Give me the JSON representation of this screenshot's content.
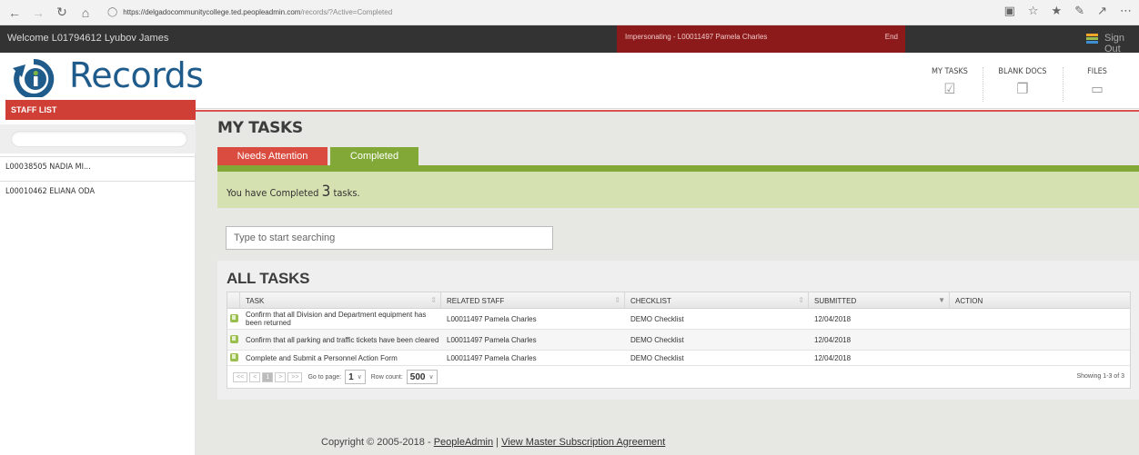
{
  "browser": {
    "url_domain": "https://delgadocommunitycollege.ted.peopleadmin.com",
    "url_path": "/records/?Active=Completed"
  },
  "topbar": {
    "welcome": "Welcome L01794612 Lyubov James",
    "impersonating": "Impersonating - L00011497 Pamela Charles",
    "end": "End",
    "sign_out": "Sign Out",
    "menu_colors": [
      "#f4a62a",
      "#9bbf4f",
      "#3d8fd1"
    ]
  },
  "header": {
    "logo_text": "Records",
    "nav": [
      {
        "label": "MY TASKS",
        "icon": "checkbox-icon"
      },
      {
        "label": "BLANK DOCS",
        "icon": "documents-icon"
      },
      {
        "label": "FILES",
        "icon": "inbox-icon"
      }
    ]
  },
  "sidebar": {
    "title": "STAFF LIST",
    "items": [
      "L00038505 NADIA MI...",
      "L00010462 ELIANA ODA"
    ]
  },
  "main": {
    "title": "MY TASKS",
    "tabs": [
      "Needs Attention",
      "Completed"
    ],
    "banner_prefix": "You have Completed ",
    "banner_count": "3",
    "banner_suffix": " tasks.",
    "search_placeholder": "Type to start searching"
  },
  "all_tasks": {
    "title": "ALL TASKS",
    "columns": [
      "TASK",
      "RELATED STAFF",
      "CHECKLIST",
      "SUBMITTED",
      "ACTION"
    ],
    "rows": [
      {
        "task": "Confirm that all Division and Department equipment has been returned",
        "staff": "L00011497 Pamela Charles",
        "checklist": "DEMO Checklist",
        "submitted": "12/04/2018",
        "action": ""
      },
      {
        "task": "Confirm that all parking and traffic tickets have been cleared",
        "staff": "L00011497 Pamela Charles",
        "checklist": "DEMO Checklist",
        "submitted": "12/04/2018",
        "action": ""
      },
      {
        "task": "Complete and Submit a Personnel Action Form",
        "staff": "L00011497 Pamela Charles",
        "checklist": "DEMO Checklist",
        "submitted": "12/04/2018",
        "action": ""
      }
    ],
    "pager": {
      "first": "<<",
      "prev": "<",
      "page": "1",
      "next": ">",
      "last": ">>",
      "goto_label": "Go to page:",
      "goto_value": "1",
      "row_count_label": "Row count:",
      "row_count_value": "500",
      "showing": "Showing 1-3 of 3"
    }
  },
  "footer": {
    "copyright": "Copyright © 2005-2018 - ",
    "link1": "PeopleAdmin",
    "sep": " | ",
    "link2": "View Master Subscription Agreement"
  }
}
